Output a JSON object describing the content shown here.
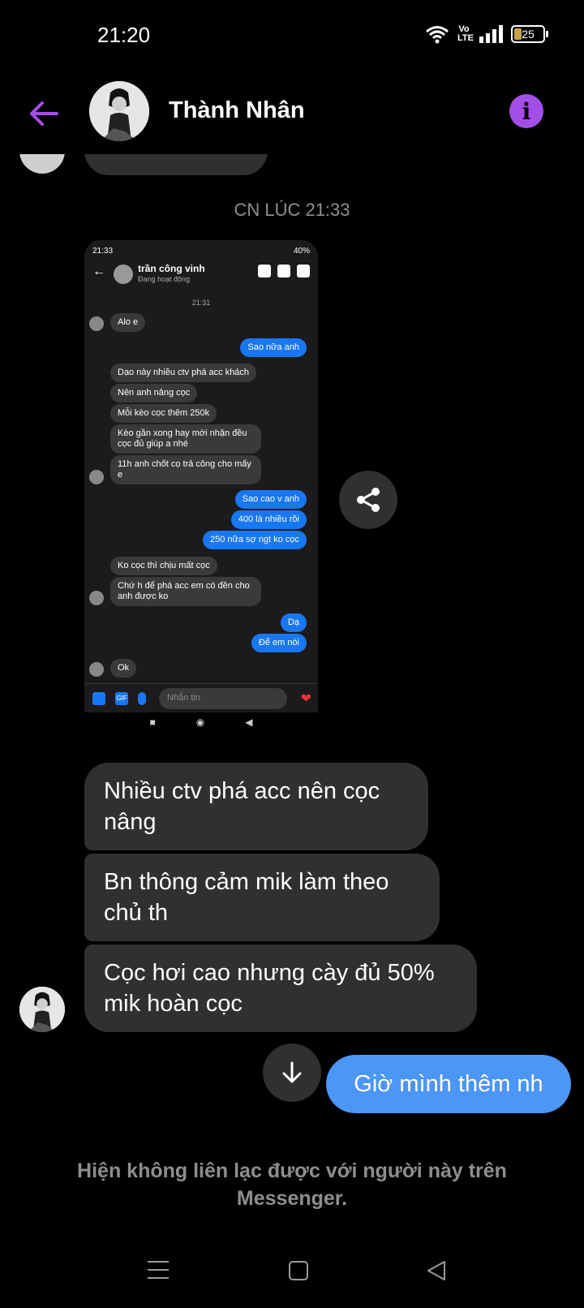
{
  "status_bar": {
    "time": "21:20",
    "network_label": "Vo LTE",
    "battery_level": "25",
    "battery_fraction": 0.25
  },
  "header": {
    "contact_name": "Thành Nhân"
  },
  "colors": {
    "accent": "#a44ee8",
    "bubble_incoming": "#303030",
    "bubble_outgoing": "#4c96f7",
    "background": "#000000"
  },
  "timestamp": "CN LÚC 21:33",
  "screenshot": {
    "status_time": "21:33",
    "status_battery": "40%",
    "contact_name": "trần công vinh",
    "contact_status": "Đang hoạt động",
    "time": "21:31",
    "messages": [
      {
        "dir": "in",
        "text": "Alo e"
      },
      {
        "dir": "out",
        "text": "Sao nữa anh"
      },
      {
        "dir": "in",
        "text": "Dạo này nhiều ctv phá acc khách"
      },
      {
        "dir": "in",
        "text": "Nên anh nâng cọc"
      },
      {
        "dir": "in",
        "text": "Mỗi kèo cọc thêm 250k"
      },
      {
        "dir": "in",
        "text": "Kèo gần xong hay mới nhận đều cọc đủ giúp a nhé"
      },
      {
        "dir": "in",
        "text": "11h anh chốt cọ trả công cho mấy e"
      },
      {
        "dir": "out",
        "text": "Sao cao v anh"
      },
      {
        "dir": "out",
        "text": "400 là nhiều rồi"
      },
      {
        "dir": "out",
        "text": "250 nữa sợ ngt ko cọc"
      },
      {
        "dir": "in",
        "text": "Ko cọc thì chịu mất cọc"
      },
      {
        "dir": "in",
        "text": "Chứ h để phá acc em có đền cho anh được ko"
      },
      {
        "dir": "out",
        "text": "Dạ"
      },
      {
        "dir": "out",
        "text": "Để em nói"
      },
      {
        "dir": "in",
        "text": "Ok"
      }
    ],
    "input_placeholder": "Nhắn tin",
    "gif_label": "GIF"
  },
  "messages": [
    {
      "text": "Nhiều ctv phá acc nên cọc nâng"
    },
    {
      "text": "Bn thông cảm mik làm theo chủ th"
    },
    {
      "text": "Cọc hơi cao nhưng cày đủ 50% mik hoàn cọc"
    }
  ],
  "outgoing_message": "Giờ mình thêm nh",
  "notice": "Hiện không liên lạc được với người này trên Messenger."
}
